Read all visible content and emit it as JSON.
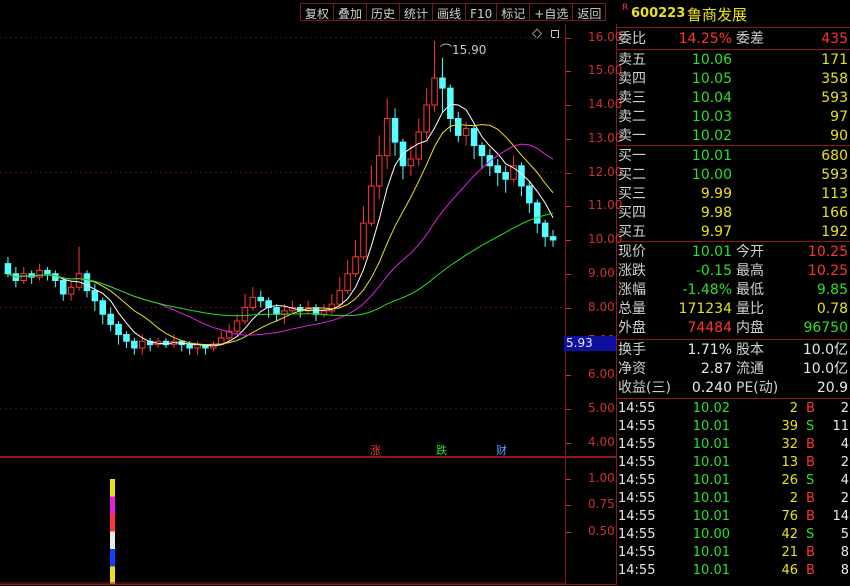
{
  "toolbar": [
    "复权",
    "叠加",
    "历史",
    "统计",
    "画线",
    "F10",
    "标记",
    "+自选",
    "返回"
  ],
  "stock": {
    "badge": "R",
    "code": "600223",
    "name": "鲁商发展"
  },
  "diamond_icon": "◇",
  "price_axis": [
    "16.00",
    "15.00",
    "14.00",
    "13.00",
    "12.00",
    "11.00",
    "10.00",
    "9.00",
    "8.00",
    "7.00",
    "6.00",
    "5.00",
    "4.00"
  ],
  "current_price_tag": "5.93",
  "max_annotation": "15.90",
  "markers": [
    {
      "text": "涨",
      "color": "#ff3535"
    },
    {
      "text": "跌",
      "color": "#2ae02a"
    },
    {
      "text": "财",
      "color": "#5aa0ff"
    }
  ],
  "volume_axis": [
    "1.00",
    "0.75",
    "0.50"
  ],
  "order_ratio": {
    "label1": "委比",
    "value1": "14.25%",
    "label2": "委差",
    "value2": "435"
  },
  "asks": [
    {
      "label": "卖五",
      "price": "10.06",
      "vol": "171"
    },
    {
      "label": "卖四",
      "price": "10.05",
      "vol": "358"
    },
    {
      "label": "卖三",
      "price": "10.04",
      "vol": "593"
    },
    {
      "label": "卖二",
      "price": "10.03",
      "vol": "97"
    },
    {
      "label": "卖一",
      "price": "10.02",
      "vol": "90"
    }
  ],
  "bids": [
    {
      "label": "买一",
      "price": "10.01",
      "vol": "680"
    },
    {
      "label": "买二",
      "price": "10.00",
      "vol": "593"
    },
    {
      "label": "买三",
      "price": "9.99",
      "vol": "113"
    },
    {
      "label": "买四",
      "price": "9.98",
      "vol": "166"
    },
    {
      "label": "买五",
      "price": "9.97",
      "vol": "192"
    }
  ],
  "quote": [
    {
      "l1": "现价",
      "v1": "10.01",
      "c1": "green",
      "l2": "今开",
      "v2": "10.25",
      "c2": "red"
    },
    {
      "l1": "涨跌",
      "v1": "-0.15",
      "c1": "green",
      "l2": "最高",
      "v2": "10.25",
      "c2": "red"
    },
    {
      "l1": "涨幅",
      "v1": "-1.48%",
      "c1": "green",
      "l2": "最低",
      "v2": "9.85",
      "c2": "green"
    },
    {
      "l1": "总量",
      "v1": "171234",
      "c1": "yellow",
      "l2": "量比",
      "v2": "0.78",
      "c2": "yellow"
    },
    {
      "l1": "外盘",
      "v1": "74484",
      "c1": "red",
      "l2": "内盘",
      "v2": "96750",
      "c2": "green"
    }
  ],
  "fundamentals": [
    {
      "l1": "换手",
      "v1": "1.71%",
      "l2": "股本",
      "v2": "10.0亿"
    },
    {
      "l1": "净资",
      "v1": "2.87",
      "l2": "流通",
      "v2": "10.0亿"
    },
    {
      "l1": "收益(三)",
      "v1": "0.240",
      "l2": "PE(动)",
      "v2": "20.9"
    }
  ],
  "trades": [
    {
      "time": "14:55",
      "price": "10.02",
      "vol": "2",
      "side": "B",
      "n": "2"
    },
    {
      "time": "14:55",
      "price": "10.01",
      "vol": "39",
      "side": "S",
      "n": "11"
    },
    {
      "time": "14:55",
      "price": "10.01",
      "vol": "32",
      "side": "B",
      "n": "4"
    },
    {
      "time": "14:55",
      "price": "10.01",
      "vol": "13",
      "side": "B",
      "n": "2"
    },
    {
      "time": "14:55",
      "price": "10.01",
      "vol": "26",
      "side": "S",
      "n": "4"
    },
    {
      "time": "14:55",
      "price": "10.01",
      "vol": "2",
      "side": "B",
      "n": "2"
    },
    {
      "time": "14:55",
      "price": "10.01",
      "vol": "76",
      "side": "B",
      "n": "14"
    },
    {
      "time": "14:55",
      "price": "10.00",
      "vol": "42",
      "side": "S",
      "n": "5"
    },
    {
      "time": "14:55",
      "price": "10.01",
      "vol": "21",
      "side": "B",
      "n": "8"
    },
    {
      "time": "14:55",
      "price": "10.01",
      "vol": "46",
      "side": "B",
      "n": "8"
    }
  ],
  "chart_data": {
    "type": "candlestick",
    "ylim": [
      3.6,
      16.4
    ],
    "candles": [
      [
        9.3,
        9.0,
        9.5,
        8.9
      ],
      [
        9.0,
        8.8,
        9.2,
        8.6
      ],
      [
        8.8,
        9.0,
        9.2,
        8.7
      ],
      [
        9.0,
        8.9,
        9.1,
        8.7
      ],
      [
        8.9,
        9.1,
        9.3,
        8.8
      ],
      [
        9.1,
        9.0,
        9.2,
        8.8
      ],
      [
        9.0,
        8.8,
        9.1,
        8.6
      ],
      [
        8.8,
        8.4,
        8.9,
        8.2
      ],
      [
        8.4,
        8.6,
        8.8,
        8.2
      ],
      [
        8.6,
        9.0,
        9.8,
        8.5
      ],
      [
        9.0,
        8.5,
        9.1,
        8.3
      ],
      [
        8.5,
        8.2,
        8.7,
        7.9
      ],
      [
        8.2,
        7.8,
        8.3,
        7.5
      ],
      [
        7.8,
        7.5,
        8.0,
        7.3
      ],
      [
        7.5,
        7.2,
        7.6,
        6.9
      ],
      [
        7.2,
        7.0,
        7.3,
        6.8
      ],
      [
        7.0,
        6.8,
        7.1,
        6.6
      ],
      [
        6.8,
        7.0,
        7.2,
        6.6
      ],
      [
        7.0,
        6.9,
        7.1,
        6.7
      ],
      [
        6.9,
        7.0,
        7.1,
        6.8
      ],
      [
        7.0,
        6.9,
        7.1,
        6.8
      ],
      [
        6.9,
        7.0,
        7.2,
        6.8
      ],
      [
        7.0,
        6.9,
        7.0,
        6.7
      ],
      [
        6.9,
        6.8,
        7.0,
        6.6
      ],
      [
        6.8,
        6.9,
        7.0,
        6.6
      ],
      [
        6.9,
        6.8,
        6.9,
        6.6
      ],
      [
        6.8,
        6.9,
        7.0,
        6.7
      ],
      [
        6.9,
        7.1,
        7.3,
        6.9
      ],
      [
        7.1,
        7.3,
        7.5,
        7.0
      ],
      [
        7.3,
        7.6,
        7.8,
        7.2
      ],
      [
        7.6,
        8.0,
        8.4,
        7.5
      ],
      [
        8.0,
        8.3,
        8.6,
        7.9
      ],
      [
        8.3,
        8.2,
        8.5,
        8.0
      ],
      [
        8.2,
        8.0,
        8.3,
        7.7
      ],
      [
        8.0,
        7.8,
        8.1,
        7.6
      ],
      [
        7.8,
        7.9,
        8.1,
        7.5
      ],
      [
        7.9,
        8.0,
        8.2,
        7.8
      ],
      [
        8.0,
        7.9,
        8.1,
        7.7
      ],
      [
        7.9,
        8.0,
        8.2,
        7.8
      ],
      [
        8.0,
        7.8,
        8.1,
        7.6
      ],
      [
        7.8,
        7.9,
        8.1,
        7.7
      ],
      [
        7.9,
        8.1,
        8.4,
        7.8
      ],
      [
        8.1,
        8.5,
        8.9,
        8.0
      ],
      [
        8.5,
        9.0,
        9.4,
        8.4
      ],
      [
        9.0,
        9.5,
        10.0,
        8.9
      ],
      [
        9.5,
        10.5,
        11.0,
        9.4
      ],
      [
        10.5,
        11.6,
        12.2,
        10.4
      ],
      [
        11.6,
        12.5,
        13.1,
        11.2
      ],
      [
        12.5,
        13.6,
        14.2,
        12.1
      ],
      [
        13.6,
        12.9,
        13.9,
        12.5
      ],
      [
        12.9,
        12.2,
        13.0,
        11.8
      ],
      [
        12.2,
        12.4,
        12.8,
        11.9
      ],
      [
        12.4,
        13.2,
        13.6,
        12.2
      ],
      [
        13.2,
        14.0,
        14.5,
        13.0
      ],
      [
        14.0,
        14.8,
        15.9,
        13.8
      ],
      [
        14.8,
        14.5,
        15.4,
        13.8
      ],
      [
        14.5,
        13.6,
        14.6,
        13.2
      ],
      [
        13.6,
        13.1,
        13.8,
        12.9
      ],
      [
        13.1,
        13.3,
        13.5,
        12.8
      ],
      [
        13.3,
        12.8,
        13.4,
        12.4
      ],
      [
        12.8,
        12.5,
        12.9,
        12.1
      ],
      [
        12.5,
        12.2,
        12.7,
        11.9
      ],
      [
        12.2,
        12.0,
        12.4,
        11.6
      ],
      [
        12.0,
        11.8,
        12.2,
        11.4
      ],
      [
        11.8,
        12.2,
        12.5,
        11.7
      ],
      [
        12.2,
        11.6,
        12.3,
        11.3
      ],
      [
        11.6,
        11.1,
        11.7,
        10.8
      ],
      [
        11.1,
        10.5,
        11.2,
        10.2
      ],
      [
        10.5,
        10.1,
        10.6,
        9.8
      ],
      [
        10.1,
        10.0,
        10.3,
        9.8
      ]
    ],
    "ma_lines": [
      {
        "color": "#ffffff",
        "name": "MA5"
      },
      {
        "color": "#e8e020",
        "name": "MA10"
      },
      {
        "color": "#e020e0",
        "name": "MA20"
      },
      {
        "color": "#20e020",
        "name": "MA60"
      }
    ],
    "volume": {
      "spike_value": 1.0,
      "ylim": [
        0,
        1.2
      ]
    }
  }
}
